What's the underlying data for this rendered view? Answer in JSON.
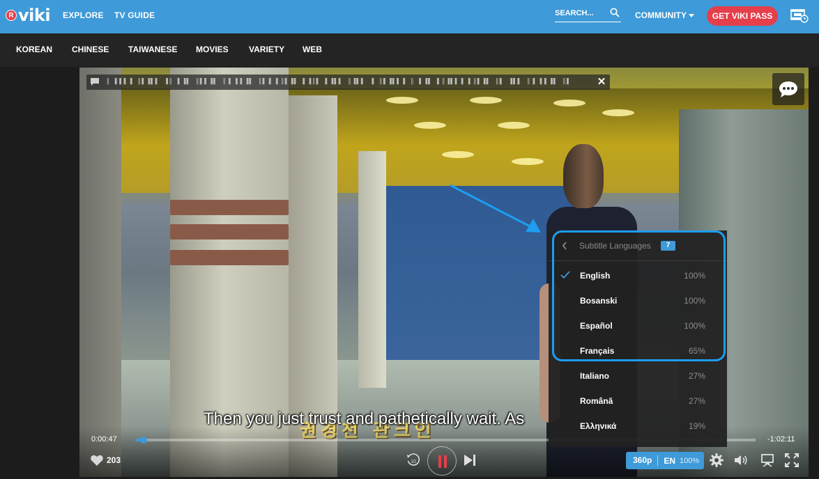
{
  "header": {
    "logo_badge": "R",
    "logo_text": "viki",
    "nav": [
      "EXPLORE",
      "TV GUIDE"
    ],
    "search_label": "SEARCH...",
    "community_label": "COMMUNITY",
    "cta_label": "GET VIKI PASS",
    "colors": {
      "bar": "#3e9ad8",
      "cta": "#e53f4b"
    }
  },
  "subnav": {
    "items": [
      "KOREAN",
      "CHINESE",
      "TAIWANESE",
      "MOVIES",
      "VARIETY",
      "WEB"
    ]
  },
  "player": {
    "notice_text": "║ ▌▌▌▐ ║▌▐▌▌ ▐║ ▌▐▌ ║▌▌▐▌ ║▐ ▌▌▐▌ ║▌▐ ▌║▌▐▌ ▌▐║▌ ▌▐▌▌ ║▐▌▌ ▐ ║▌▐▌▌▐ ║ ▌▐▌ ▌║▐▌▌▐ ▌║▌▐▌ ║▌ ▐▌▌ ║▐ ▌▌▐▌ ║▌",
    "subtitle_text": "Then you just trust and pathetically wait. As",
    "burned_in_caption": "권경천 관크인",
    "time_elapsed": "0:00:47",
    "time_remaining": "-1:02:11",
    "progress_fraction": 0.013,
    "likes": "203",
    "rewind_seconds": "10",
    "quality": "360p",
    "subtitle_lang": "EN",
    "subtitle_completion": "100%",
    "icons": [
      "chat-icon",
      "close-icon",
      "comment-icon",
      "heart-icon",
      "rewind-10-icon",
      "pause-icon",
      "next-icon",
      "gear-icon",
      "volume-icon",
      "cast-icon",
      "fullscreen-icon"
    ]
  },
  "subtitle_menu": {
    "title": "Subtitle Languages",
    "count": "7",
    "languages": [
      {
        "name": "English",
        "percent": "100%",
        "selected": true
      },
      {
        "name": "Bosanski",
        "percent": "100%",
        "selected": false
      },
      {
        "name": "Español",
        "percent": "100%",
        "selected": false
      },
      {
        "name": "Français",
        "percent": "65%",
        "selected": false
      },
      {
        "name": "Italiano",
        "percent": "27%",
        "selected": false
      },
      {
        "name": "Română",
        "percent": "27%",
        "selected": false
      },
      {
        "name": "Ελληνικά",
        "percent": "19%",
        "selected": false
      }
    ],
    "accent": "#1e9df1"
  }
}
